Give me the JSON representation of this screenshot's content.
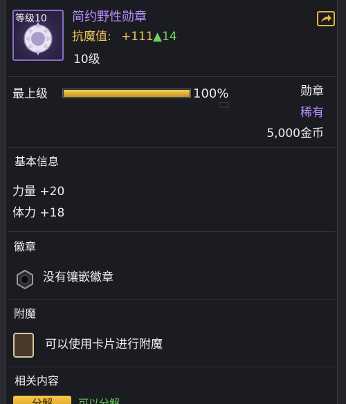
{
  "item": {
    "level_tag": "等级10",
    "name": "简约野性勋章",
    "resist_label": "抗魔值:",
    "resist_base": "+111",
    "resist_bonus": "▲14",
    "level_text": "10级",
    "icon": "wild-medal-icon"
  },
  "upgrade": {
    "label": "最上级",
    "progress_percent": 100,
    "progress_text": "100%"
  },
  "meta": {
    "type": "勋章",
    "rarity": "稀有",
    "price": "5,000金币"
  },
  "basic_info": {
    "title": "基本信息",
    "stats": [
      "力量 +20",
      "体力 +18"
    ]
  },
  "emblem": {
    "title": "徽章",
    "status": "没有镶嵌徽章"
  },
  "enchant": {
    "title": "附魔",
    "hint": "可以使用卡片进行附魔"
  },
  "related": {
    "title": "相关内容",
    "decompose_button": "分解",
    "decompose_note": "可以分解"
  },
  "colors": {
    "rare_purple": "#b58cff",
    "gold": "#e9c25a",
    "bonus_green": "#6ad35c",
    "panel_bg": "#1b1c21"
  }
}
